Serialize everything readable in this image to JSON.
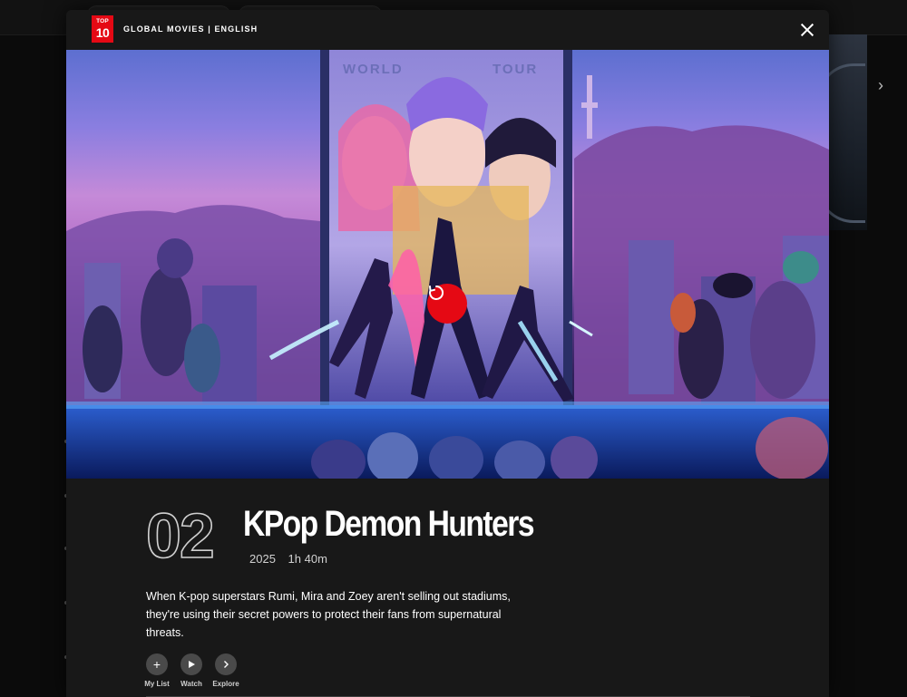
{
  "header": {
    "badge_top": "TOP",
    "badge_num": "10",
    "label": "GLOBAL MOVIES | ENGLISH"
  },
  "hero": {
    "billboard_text_left": "WORLD",
    "billboard_text_right": "TOUR"
  },
  "title": {
    "rank": "02",
    "name": "KPop Demon Hunters",
    "year": "2025",
    "duration": "1h 40m",
    "description": "When K-pop superstars Rumi, Mira and Zoey aren't selling out stadiums, they're using their secret powers to protect their fans from supernatural threats."
  },
  "actions": [
    {
      "label": "My List",
      "icon": "plus-icon"
    },
    {
      "label": "Watch",
      "icon": "play-icon"
    },
    {
      "label": "Explore",
      "icon": "chevron-right-icon"
    }
  ],
  "colors": {
    "accent": "#e50914",
    "modal_bg": "#181818",
    "page_bg": "#0b0b0b"
  }
}
